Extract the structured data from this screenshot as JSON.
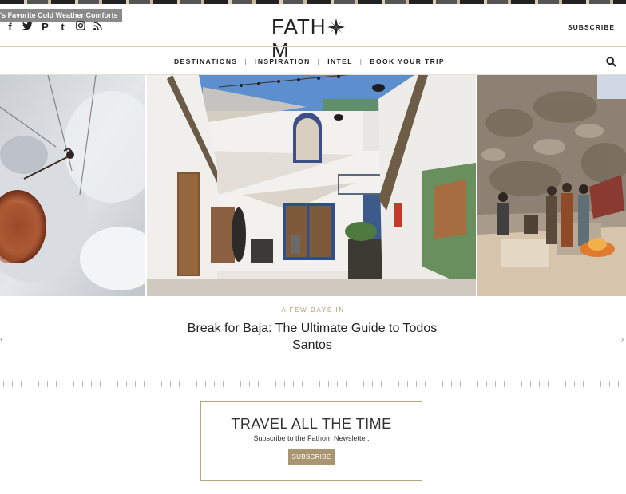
{
  "tooltip": "'s Favorite Cold Weather Comforts",
  "social": {
    "facebook": "f",
    "twitter": "twitter-icon",
    "pinterest": "P",
    "tumblr": "t",
    "instagram": "instagram-icon",
    "rss": "rss-icon"
  },
  "header": {
    "logo_left": "FATH",
    "logo_right": "M",
    "subscribe": "SUBSCRIBE"
  },
  "nav": {
    "items": [
      "DESTINATIONS",
      "INSPIRATION",
      "INTEL",
      "BOOK YOUR TRIP"
    ],
    "separator": "|"
  },
  "featured": {
    "kicker": "A FEW DAYS IN",
    "title": "Break for Baja: The Ultimate Guide to Todos Santos"
  },
  "newsletter": {
    "title": "TRAVEL ALL THE TIME",
    "subtitle": "Subscribe to the Fathom Newsletter.",
    "button": "SUBSCRIBE"
  },
  "colors": {
    "accent": "#b39a6e",
    "button": "#a99570",
    "border": "#b9a47f"
  }
}
